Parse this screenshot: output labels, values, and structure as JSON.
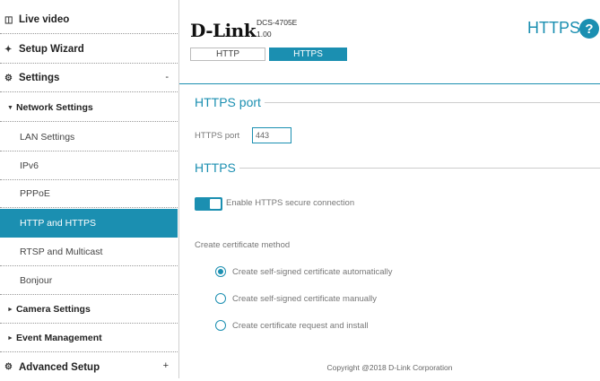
{
  "sidebar": {
    "live_video": "Live video",
    "setup_wizard": "Setup Wizard",
    "settings": "Settings",
    "settings_toggle": "-",
    "network_settings": "Network Settings",
    "lan_settings": "LAN Settings",
    "ipv6": "IPv6",
    "pppoe": "PPPoE",
    "http_https": "HTTP and HTTPS",
    "rtsp": "RTSP and Multicast",
    "bonjour": "Bonjour",
    "camera_settings": "Camera Settings",
    "event_management": "Event Management",
    "advanced_setup": "Advanced Setup",
    "advanced_toggle": "+"
  },
  "header": {
    "brand": "D-Link",
    "model": "DCS-4705E",
    "firmware": "1.00",
    "page_title": "HTTPS",
    "help": "?"
  },
  "tabs": {
    "http": "HTTP",
    "https": "HTTPS"
  },
  "https_port_section": {
    "title": "HTTPS port",
    "port_label": "HTTPS port",
    "port_value": "443"
  },
  "https_section": {
    "title": "HTTPS",
    "enable_label": "Enable HTTPS secure connection",
    "enabled": true,
    "method_label": "Create certificate method",
    "options": [
      {
        "label": "Create self-signed certificate automatically",
        "selected": true
      },
      {
        "label": "Create self-signed certificate manually",
        "selected": false
      },
      {
        "label": "Create certificate request and install",
        "selected": false
      }
    ]
  },
  "footer": {
    "copyright": "Copyright @2018 D-Link Corporation"
  },
  "colors": {
    "accent": "#1b8fb1"
  }
}
